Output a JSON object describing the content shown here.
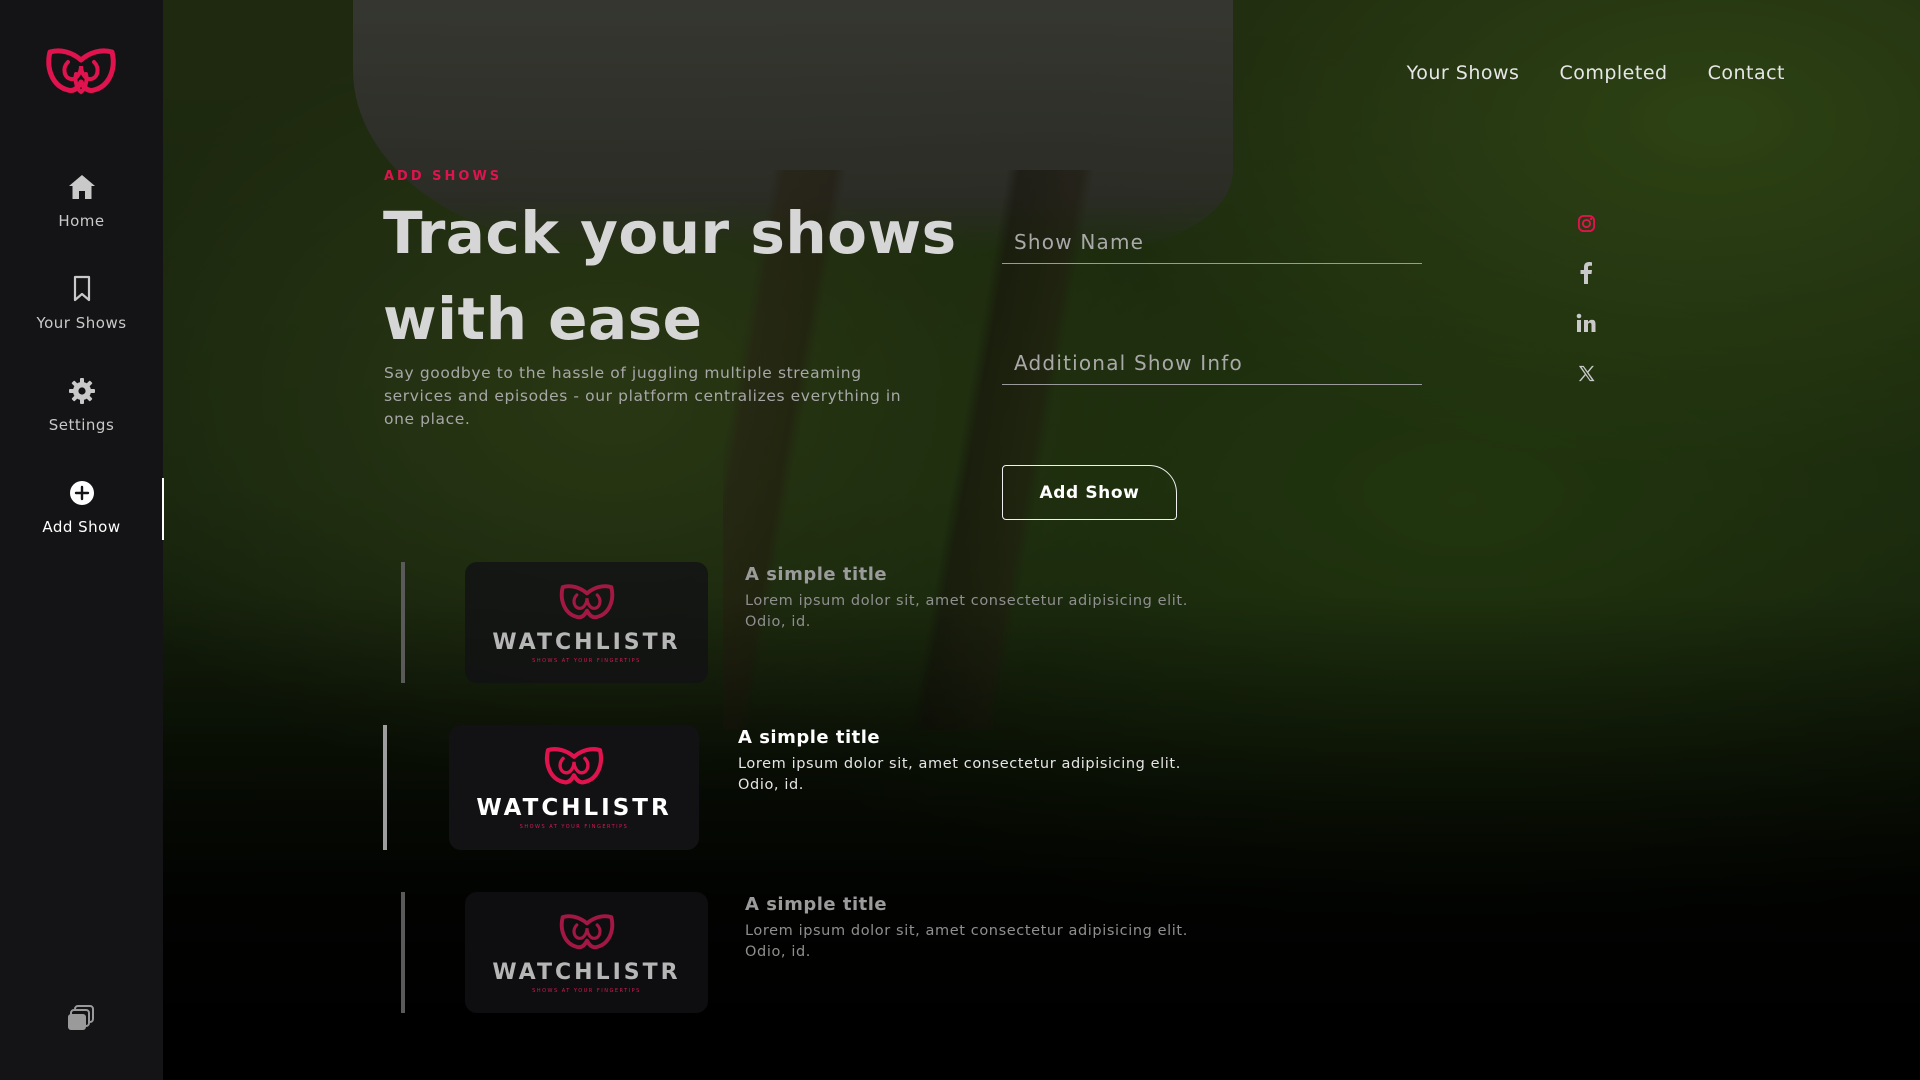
{
  "colors": {
    "accent": "#e0134e",
    "sidebar_bg": "#141416",
    "text_primary": "#ffffff"
  },
  "sidebar": {
    "logo_icon": "watchlistr-logo",
    "items": [
      {
        "label": "Home",
        "icon": "home-icon"
      },
      {
        "label": "Your Shows",
        "icon": "bookmark-icon"
      },
      {
        "label": "Settings",
        "icon": "gear-icon"
      },
      {
        "label": "Add Show",
        "icon": "plus-circle-icon",
        "active": true
      }
    ],
    "bottom_icon": "stack-icon"
  },
  "topnav": {
    "items": [
      "Your Shows",
      "Completed",
      "Contact"
    ]
  },
  "hero": {
    "eyebrow": "ADD SHOWS",
    "title_line1": "Track your shows",
    "title_line2": "with ease",
    "description": "Say goodbye to the hassle of juggling multiple streaming services and episodes - our platform centralizes everything in one place."
  },
  "form": {
    "show_name_placeholder": "Show Name",
    "show_name_value": "",
    "info_placeholder": "Additional Show Info",
    "info_value": "",
    "submit_label": "Add Show"
  },
  "social": [
    "instagram-icon",
    "facebook-icon",
    "linkedin-icon",
    "x-icon"
  ],
  "cards": [
    {
      "brand": "WATCHLISTR",
      "tagline": "SHOWS AT YOUR FINGERTIPS",
      "title": "A simple title",
      "desc": "Lorem ipsum dolor sit, amet consectetur adipisicing elit. Odio, id."
    },
    {
      "brand": "WATCHLISTR",
      "tagline": "SHOWS AT YOUR FINGERTIPS",
      "title": "A simple title",
      "desc": "Lorem ipsum dolor sit, amet consectetur adipisicing elit. Odio, id."
    },
    {
      "brand": "WATCHLISTR",
      "tagline": "SHOWS AT YOUR FINGERTIPS",
      "title": "A simple title",
      "desc": "Lorem ipsum dolor sit, amet consectetur adipisicing elit. Odio, id."
    }
  ]
}
